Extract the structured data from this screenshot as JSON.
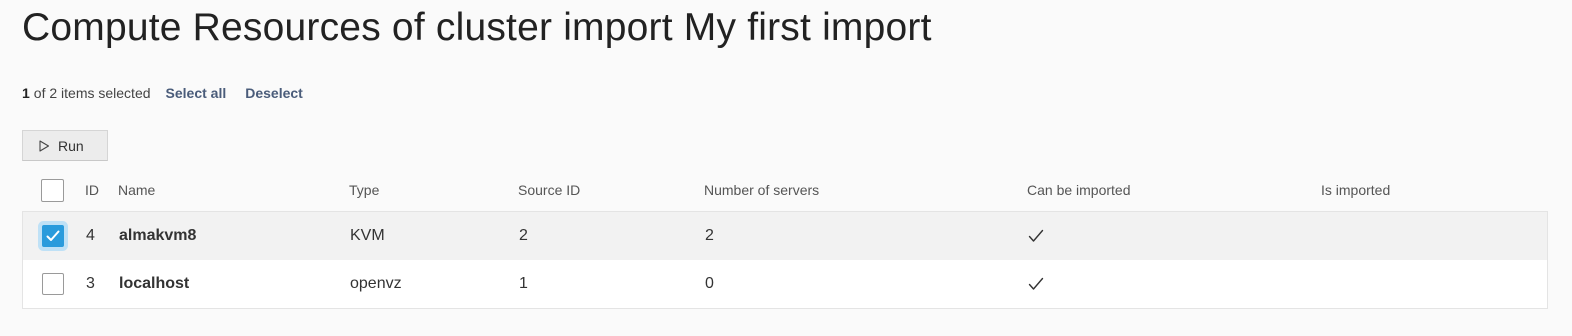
{
  "page": {
    "title": "Compute Resources of cluster import My first import"
  },
  "selection": {
    "count": "1",
    "text": "of 2 items selected",
    "select_all": "Select all",
    "deselect": "Deselect"
  },
  "toolbar": {
    "run_label": "Run",
    "run_icon": "play-icon"
  },
  "table": {
    "columns": {
      "id": "ID",
      "name": "Name",
      "type": "Type",
      "source_id": "Source ID",
      "servers": "Number of servers",
      "can_import": "Can be imported",
      "is_imported": "Is imported"
    },
    "rows": [
      {
        "selected": true,
        "id": "4",
        "name": "almakvm8",
        "type": "KVM",
        "source_id": "2",
        "servers": "2",
        "can_import": true,
        "is_imported": false
      },
      {
        "selected": false,
        "id": "3",
        "name": "localhost",
        "type": "openvz",
        "source_id": "1",
        "servers": "0",
        "can_import": true,
        "is_imported": false
      }
    ]
  },
  "colors": {
    "accent": "#2a9bdc",
    "link": "#4a5c7a",
    "selected_row_bg": "#f2f2f2"
  }
}
